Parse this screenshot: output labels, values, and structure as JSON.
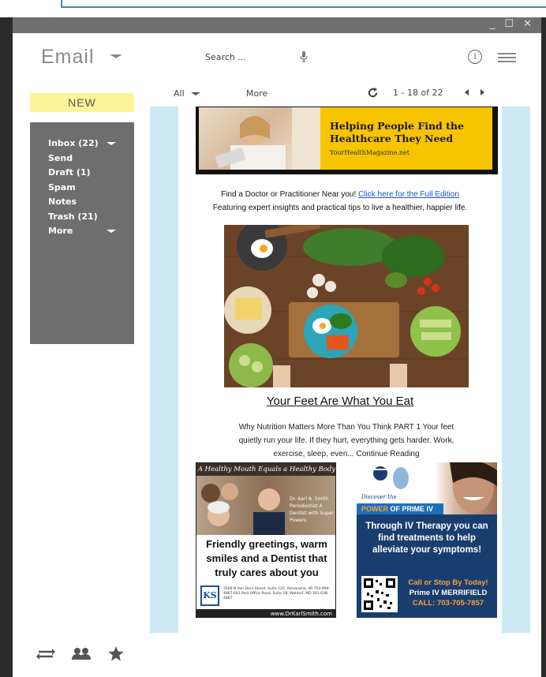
{
  "window_controls": "_ ☐ ✕",
  "header": {
    "title": "Email",
    "search_placeholder": "Search ...",
    "info_symbol": "i"
  },
  "sidebar": {
    "new_button": "NEW",
    "folders": [
      {
        "label": "Inbox (22)"
      },
      {
        "label": "Send"
      },
      {
        "label": "Draft (1)"
      },
      {
        "label": "Spam"
      },
      {
        "label": "Notes"
      },
      {
        "label": "Trash (21)"
      },
      {
        "label": "More"
      }
    ]
  },
  "toolbar": {
    "filter_label": "All",
    "more_label": "More",
    "page_count": "1 - 18 of 22"
  },
  "email": {
    "banner_title": "Helping People Find the Healthcare They Need",
    "banner_site": "YourHealthMagazine.net",
    "intro_text": "Find a Doctor or Practitioner Near you! ",
    "intro_link": "Click here for the Full Edition",
    "tagline": "Featuring expert insights and practical tips to live a healthier, happier life.",
    "article_title": "Your Feet Are What You Eat",
    "article_excerpt": "Why Nutrition Matters More Than You Think PART 1 Your feet quietly run your life. If they hurt, everything gets harder. Work, exercise, sleep, even... Continue Reading"
  },
  "ads": {
    "dentist": {
      "header": "A Healthy Mouth Equals a Healthy Body",
      "caption": "Dr. Karl A. Smith Periodontist A Dentist with Super Powers",
      "body": "Friendly greetings, warm smiles and a Dentist that truly cares about you",
      "logo": "KS",
      "address": "3500 N Van Dorn Street, Suite 120, Alexandria, VA 703-894-4867 601 Post Office Road, Suite 1B, Waldorf, MD 301-638-4867",
      "url": "www.DrKarlSmith.com"
    },
    "iv": {
      "brand": "Discover the",
      "band_prefix": "POWER",
      "band_suffix": " OF PRIME IV",
      "body": "Through IV Therapy you can find treatments to help alleviate your symptoms!",
      "cta1": "Call or Stop By Today!",
      "cta2": "Prime IV MERRIFIELD",
      "cta3": "CALL: 703-705-7857"
    }
  },
  "colors": {
    "new_button": "#fbf49a",
    "sidebar": "#6e6e6e",
    "content_bg": "#cde9f4",
    "banner_yellow": "#f8c400",
    "link": "#1a55d8"
  }
}
